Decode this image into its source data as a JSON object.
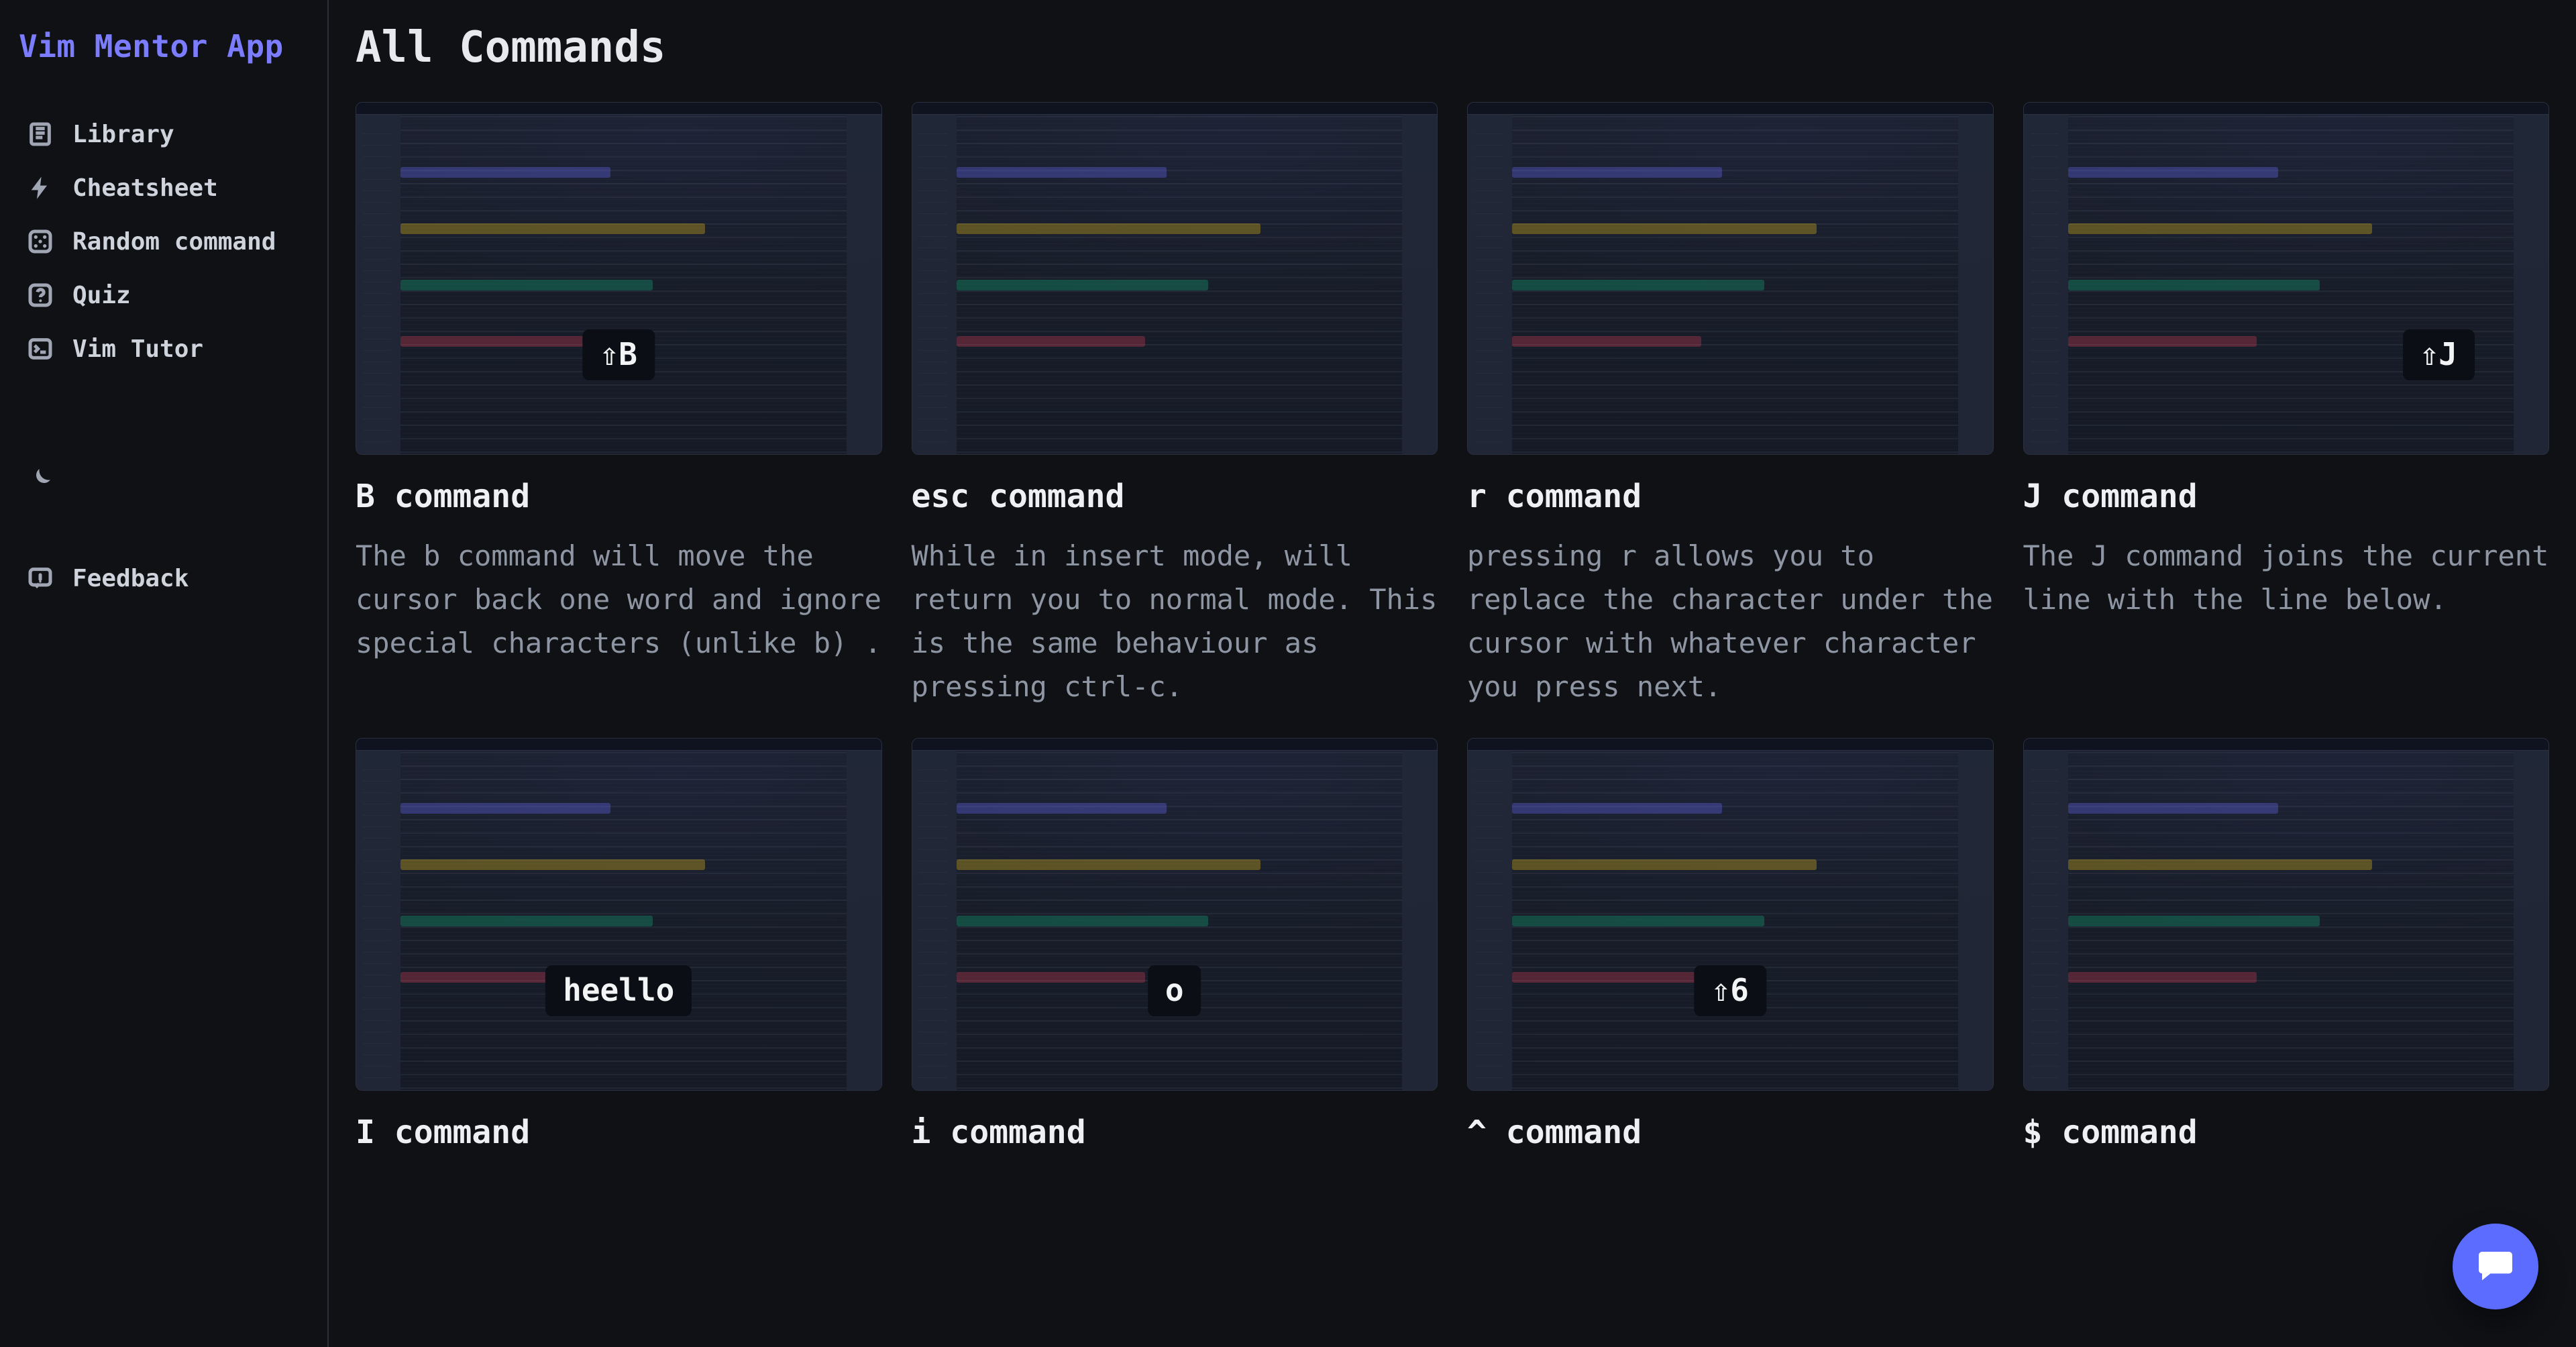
{
  "app": {
    "name": "Vim Mentor App"
  },
  "sidebar": {
    "items": [
      {
        "label": "Library"
      },
      {
        "label": "Cheatsheet"
      },
      {
        "label": "Random command"
      },
      {
        "label": "Quiz"
      },
      {
        "label": "Vim Tutor"
      }
    ],
    "feedback_label": "Feedback"
  },
  "page": {
    "title": "All Commands"
  },
  "cards": [
    {
      "badge": "⇧B",
      "badge_pos": "center",
      "title": "B command",
      "desc": "The b command will move the cursor back one word and ignore special characters (unlike b) ."
    },
    {
      "badge": "",
      "badge_pos": "none",
      "title": "esc command",
      "desc": "While in insert mode, will return you to normal mode. This is the same behaviour as pressing ctrl-c."
    },
    {
      "badge": "",
      "badge_pos": "none",
      "title": "r command",
      "desc": "pressing r allows you to replace the character under the cursor with whatever character you press next."
    },
    {
      "badge": "⇧J",
      "badge_pos": "right",
      "title": "J command",
      "desc": "The J command joins the current line with the line below."
    },
    {
      "badge": "heello",
      "badge_pos": "center",
      "title": "I command",
      "desc": ""
    },
    {
      "badge": "o",
      "badge_pos": "center",
      "title": "i command",
      "desc": ""
    },
    {
      "badge": "⇧6",
      "badge_pos": "center",
      "title": "^ command",
      "desc": ""
    },
    {
      "badge": "",
      "badge_pos": "none",
      "title": "$ command",
      "desc": ""
    }
  ]
}
